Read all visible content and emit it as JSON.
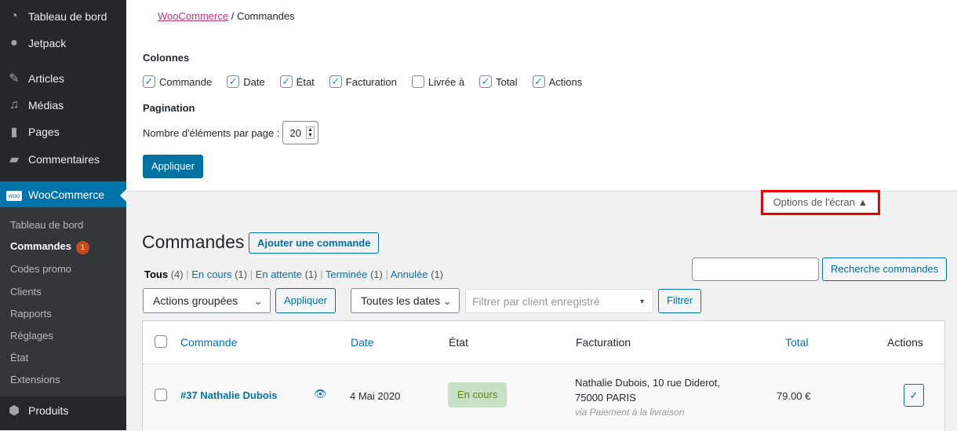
{
  "sidebar": {
    "items": [
      {
        "label": "Tableau de bord",
        "icon": "dashboard-icon"
      },
      {
        "label": "Jetpack",
        "icon": "jetpack-icon"
      },
      {
        "label": "Articles",
        "icon": "pin-icon"
      },
      {
        "label": "Médias",
        "icon": "media-icon"
      },
      {
        "label": "Pages",
        "icon": "pages-icon"
      },
      {
        "label": "Commentaires",
        "icon": "comment-icon"
      },
      {
        "label": "WooCommerce",
        "icon": "woo-icon"
      },
      {
        "label": "Produits",
        "icon": "box-icon"
      }
    ],
    "submenu": [
      "Tableau de bord",
      "Commandes",
      "Codes promo",
      "Clients",
      "Rapports",
      "Réglages",
      "État",
      "Extensions"
    ],
    "badge": "1",
    "woo_logo": "woo"
  },
  "breadcrumb": {
    "root": "WooCommerce",
    "sep": "/",
    "current": "Commandes"
  },
  "screen_options": {
    "columns_title": "Colonnes",
    "columns": [
      {
        "label": "Commande",
        "checked": true
      },
      {
        "label": "Date",
        "checked": true
      },
      {
        "label": "État",
        "checked": true
      },
      {
        "label": "Facturation",
        "checked": true
      },
      {
        "label": "Livrée à",
        "checked": false
      },
      {
        "label": "Total",
        "checked": true
      },
      {
        "label": "Actions",
        "checked": true
      }
    ],
    "pagination_title": "Pagination",
    "per_page_label": "Nombre d'éléments par page :",
    "per_page": "20",
    "apply": "Appliquer",
    "tab": "Options de l'écran ▲"
  },
  "page": {
    "title": "Commandes",
    "add": "Ajouter une commande",
    "filters": [
      {
        "label": "Tous",
        "count": "(4)"
      },
      {
        "label": "En cours",
        "count": "(1)"
      },
      {
        "label": "En attente",
        "count": "(1)"
      },
      {
        "label": "Terminée",
        "count": "(1)"
      },
      {
        "label": "Annulée",
        "count": "(1)"
      }
    ],
    "search_button": "Recherche commandes",
    "bulk": "Actions groupées",
    "apply": "Appliquer",
    "dates": "Toutes les dates",
    "customer_placeholder": "Filtrer par client enregistré",
    "filter": "Filtrer"
  },
  "table": {
    "headers": [
      "Commande",
      "Date",
      "État",
      "Facturation",
      "Total",
      "Actions"
    ],
    "rows": [
      {
        "order": "#37 Nathalie Dubois",
        "date": "4 Mai 2020",
        "status": "En cours",
        "billing1": "Nathalie Dubois, 10 rue Diderot,",
        "billing2": "75000 PARIS",
        "payment": "via Paiement à la livraison",
        "total": "79.00 €"
      }
    ]
  }
}
